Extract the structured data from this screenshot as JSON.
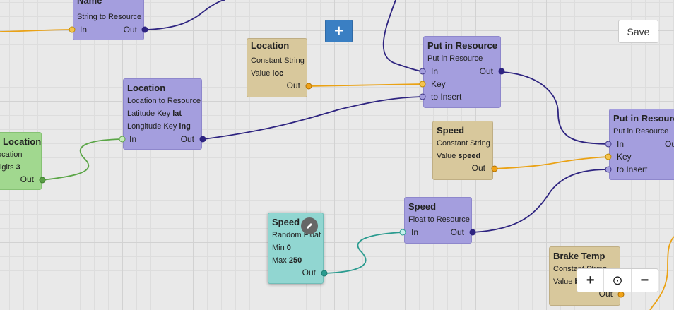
{
  "toolbar": {
    "add_label": "+",
    "save_label": "Save"
  },
  "zoom": {
    "in_label": "+",
    "reset_label": "⊙",
    "out_label": "−"
  },
  "nodes": {
    "name_str": {
      "title": "Name",
      "type": "String to Resource",
      "in": "In",
      "out": "Out"
    },
    "loc_const": {
      "title": "Location",
      "type": "Constant String",
      "value_label": "Value",
      "value": "loc",
      "out": "Out"
    },
    "put1": {
      "title": "Put in Resource",
      "type": "Put in Resource",
      "in": "In",
      "out": "Out",
      "key": "Key",
      "insert": "to Insert"
    },
    "loc_res": {
      "title": "Location",
      "type": "Location to Resource",
      "lat_label": "Latitude Key",
      "lat": "lat",
      "lng_label": "Longitude Key",
      "lng": "lng",
      "in": "In",
      "out": "Out"
    },
    "loc_green": {
      "title": "Location",
      "type": "ocation",
      "digits_label": "Digits",
      "digits": "3",
      "out": "Out"
    },
    "speed_const": {
      "title": "Speed",
      "type": "Constant String",
      "value_label": "Value",
      "value": "speed",
      "out": "Out"
    },
    "put2": {
      "title": "Put in Resource",
      "type": "Put in Resource",
      "in": "In",
      "out": "Ou",
      "key": "Key",
      "insert": "to Insert"
    },
    "speed_float": {
      "title": "Speed",
      "type": "Float to Resource",
      "in": "In",
      "out": "Out"
    },
    "speed_rand": {
      "title": "Speed",
      "type": "Random Float",
      "min_label": "Min",
      "min": "0",
      "max_label": "Max",
      "max": "250",
      "out": "Out"
    },
    "brake": {
      "title": "Brake Temp",
      "type": "Constant String",
      "value_label": "Value",
      "value": "b",
      "out": "Out"
    }
  },
  "colors": {
    "purple_wire": "#2e2480",
    "orange_wire": "#eaa215",
    "green_wire": "#5aa546",
    "teal_wire": "#2a9b8f",
    "accent": "#3a7fc3"
  },
  "icons": {
    "edit": "pencil-icon",
    "add": "plus-icon",
    "zoom_in": "plus-icon",
    "zoom_reset": "target-icon",
    "zoom_out": "minus-icon"
  }
}
